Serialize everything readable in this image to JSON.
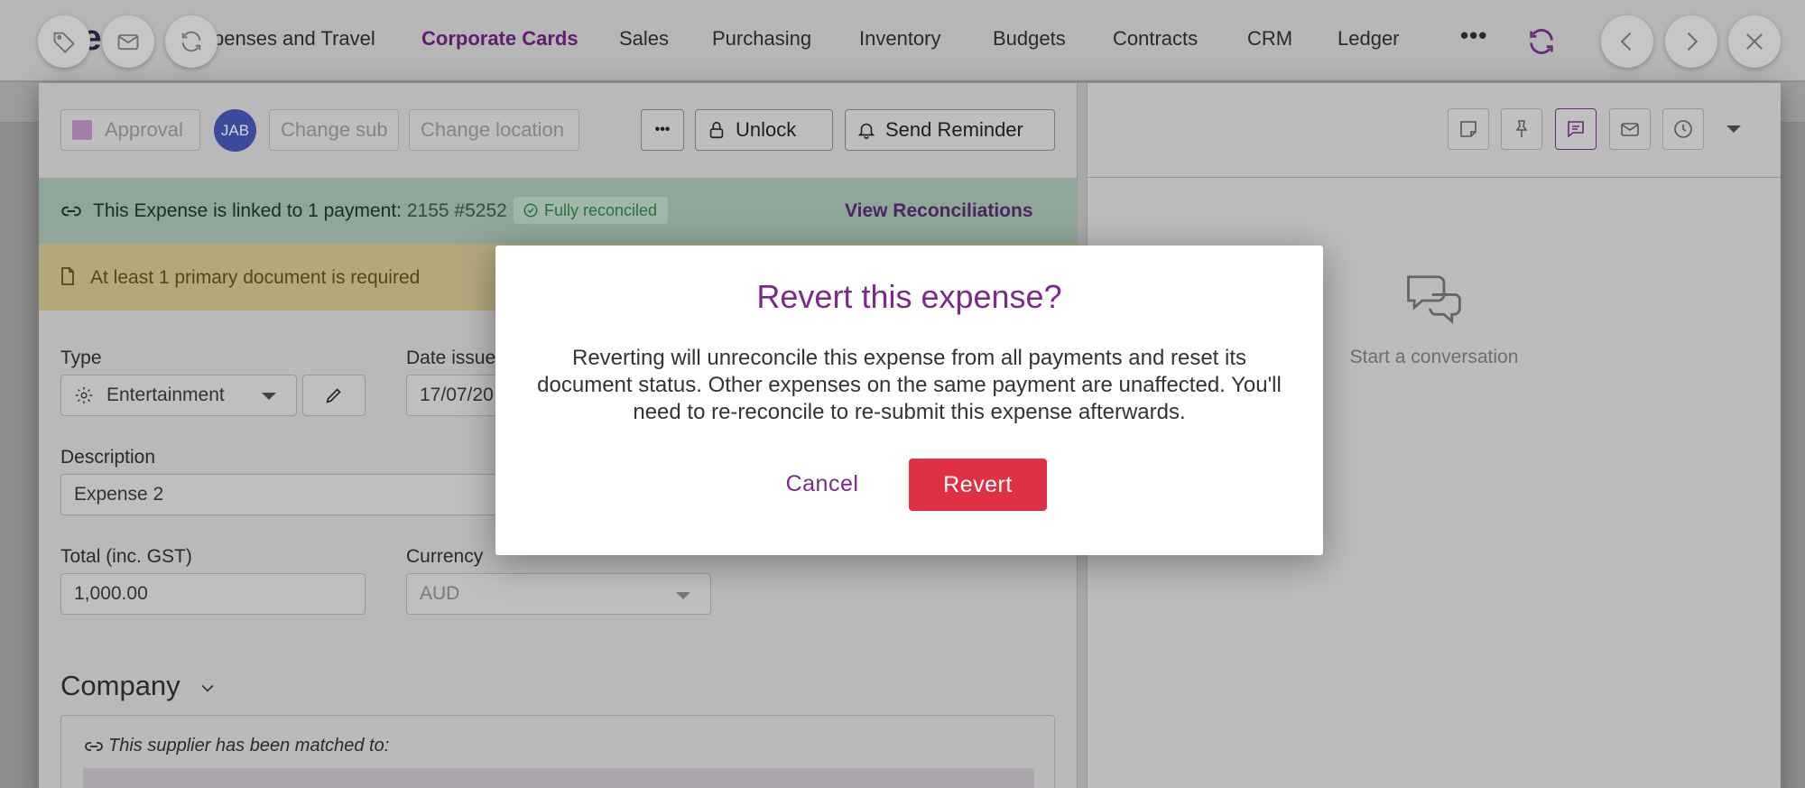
{
  "nav": {
    "logo": "de",
    "items": [
      "penses and Travel",
      "Corporate Cards",
      "Sales",
      "Purchasing",
      "Inventory",
      "Budgets",
      "Contracts",
      "CRM",
      "Ledger"
    ],
    "more": "•••"
  },
  "toolbar": {
    "approval": "Approval",
    "avatar": "JAB",
    "change_sub": "Change sub",
    "change_location": "Change location",
    "more": "•••",
    "unlock": "Unlock",
    "send_reminder": "Send Reminder"
  },
  "payment_banner": {
    "text": "This Expense is linked to 1 payment:",
    "payment_ref": "2155 #5252",
    "status": "Fully reconciled",
    "link": "View Reconciliations"
  },
  "document_banner": {
    "text": "At least 1 primary document is required"
  },
  "form": {
    "type_label": "Type",
    "type_value": "Entertainment",
    "date_label": "Date issued",
    "date_value": "17/07/20",
    "description_label": "Description",
    "description_value": "Expense 2",
    "total_label": "Total (inc. GST)",
    "total_value": "1,000.00",
    "currency_label": "Currency",
    "currency_value": "AUD"
  },
  "company": {
    "heading": "Company",
    "supplier_note": "This supplier has been matched to:"
  },
  "conversation": {
    "empty_text": "Start a conversation"
  },
  "modal": {
    "title": "Revert this expense?",
    "body": "Reverting will unreconcile this expense from all payments and reset its document status. Other expenses on the same payment are unaffected. You'll need to re-reconcile to re-submit this expense afterwards.",
    "cancel": "Cancel",
    "confirm": "Revert"
  },
  "colors": {
    "accent": "#7a2a8c",
    "danger": "#e03043",
    "success": "#27733c"
  }
}
